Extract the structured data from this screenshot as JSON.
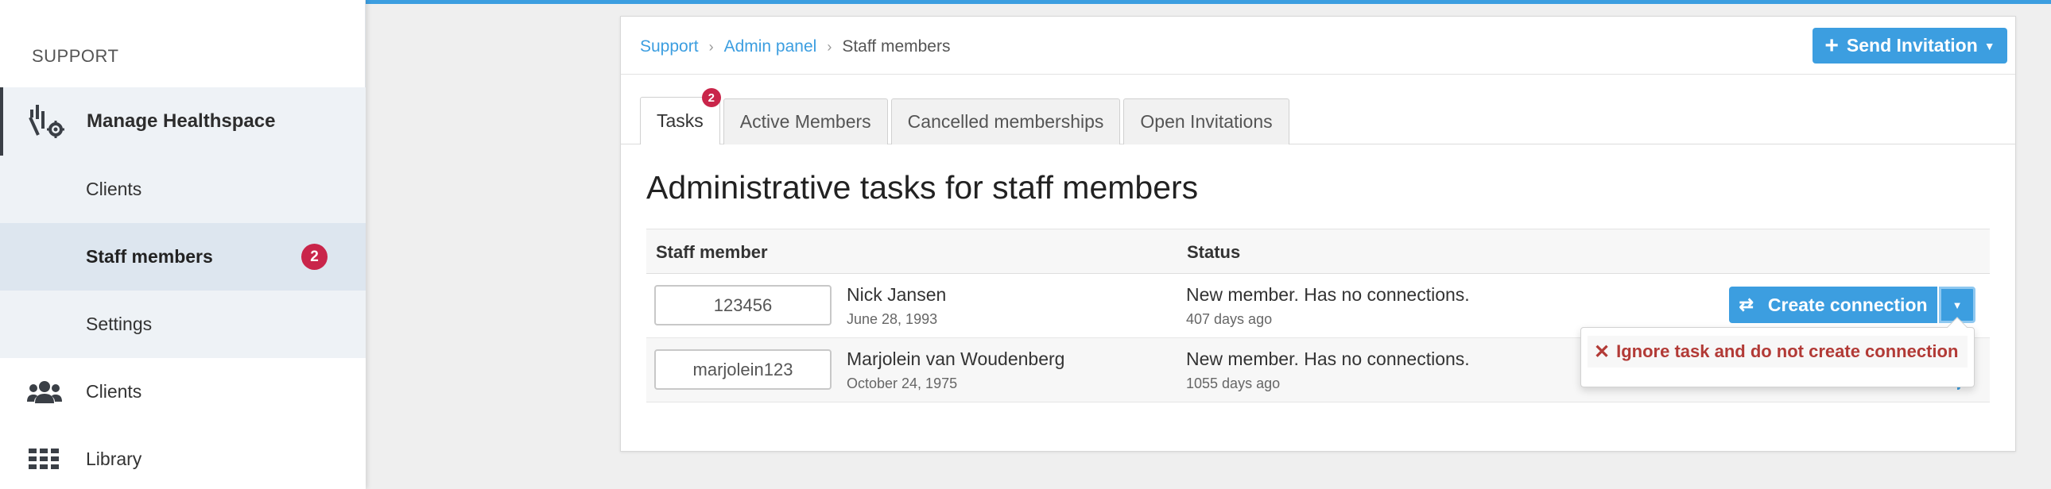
{
  "sidebar": {
    "section_label": "SUPPORT",
    "main_item": {
      "label": "Manage Healthspace",
      "icon": "manage-icon"
    },
    "sub_items": [
      {
        "label": "Clients"
      },
      {
        "label": "Staff members",
        "badge": "2"
      },
      {
        "label": "Settings"
      }
    ],
    "top_items": [
      {
        "label": "Clients",
        "icon": "users-icon"
      },
      {
        "label": "Library",
        "icon": "grid-icon"
      }
    ]
  },
  "breadcrumb": {
    "items": [
      "Support",
      "Admin panel"
    ],
    "current": "Staff members"
  },
  "header": {
    "invite_label": "Send Invitation"
  },
  "tabs": [
    {
      "label": "Tasks",
      "badge": "2",
      "active": true
    },
    {
      "label": "Active Members"
    },
    {
      "label": "Cancelled memberships"
    },
    {
      "label": "Open Invitations"
    }
  ],
  "page_title": "Administrative tasks for staff members",
  "table": {
    "columns": [
      "Staff member",
      "Status"
    ],
    "rows": [
      {
        "id": "123456",
        "name": "Nick Jansen",
        "dob": "June 28, 1993",
        "status": "New member. Has no connections.",
        "ago": "407 days ago"
      },
      {
        "id": "marjolein123",
        "name": "Marjolein van Woudenberg",
        "dob": "October 24, 1975",
        "status": "New member. Has no connections.",
        "ago": "1055 days ago"
      }
    ]
  },
  "actions": {
    "create_label": "Create connection",
    "dropdown_item": "Ignore task and do not create connection"
  },
  "colors": {
    "accent": "#3c9ee0",
    "badge": "#c9254a",
    "danger": "#b23a36"
  }
}
